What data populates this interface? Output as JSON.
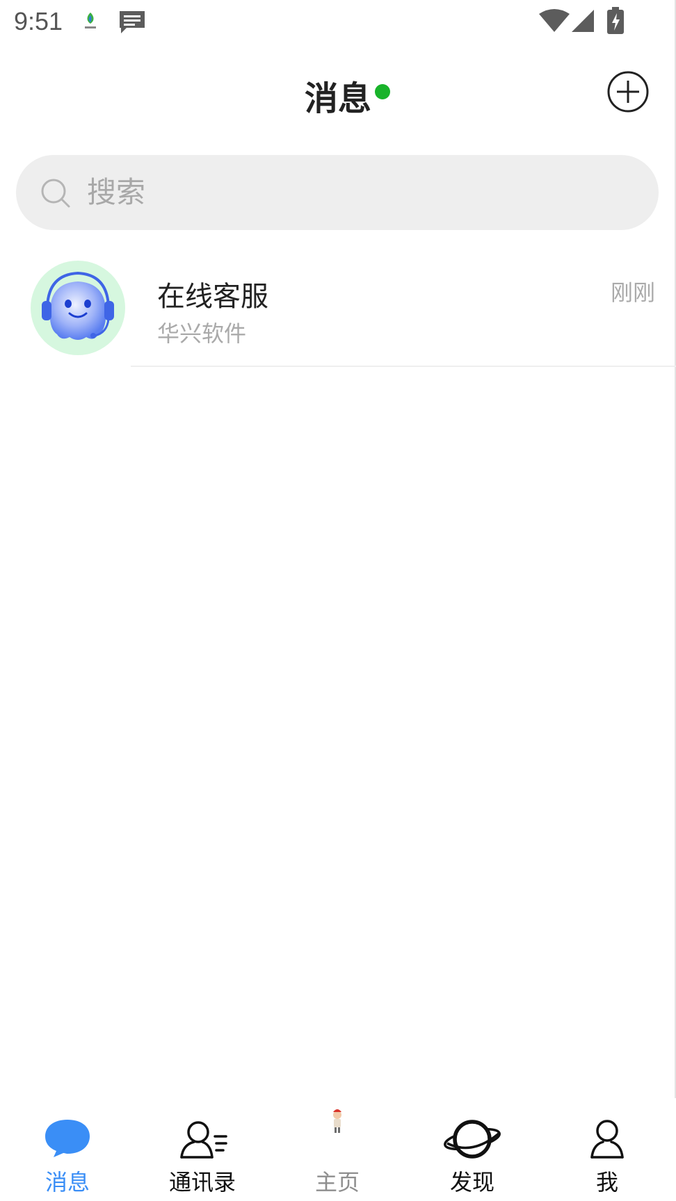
{
  "status_bar": {
    "time": "9:51",
    "icons": [
      "app-logo-icon",
      "message-notification-icon",
      "wifi-icon",
      "cell-signal-icon",
      "battery-charging-icon"
    ]
  },
  "header": {
    "title": "消息",
    "online_status_color": "#19b32a",
    "add_icon": "plus-circle-icon"
  },
  "search": {
    "placeholder": "搜索",
    "value": "",
    "icon": "search-icon"
  },
  "conversations": [
    {
      "name": "在线客服",
      "preview": "华兴软件",
      "time": "刚刚",
      "avatar": "customer-service-robot-avatar"
    }
  ],
  "bottom_nav": {
    "active_color": "#3a8ef6",
    "items": [
      {
        "label": "消息",
        "icon": "chat-bubble-icon",
        "active": true
      },
      {
        "label": "通讯录",
        "icon": "contacts-icon",
        "active": false
      },
      {
        "label": "主页",
        "icon": "home-figure-icon",
        "active": false
      },
      {
        "label": "发现",
        "icon": "planet-icon",
        "active": false
      },
      {
        "label": "我",
        "icon": "person-icon",
        "active": false
      }
    ]
  }
}
